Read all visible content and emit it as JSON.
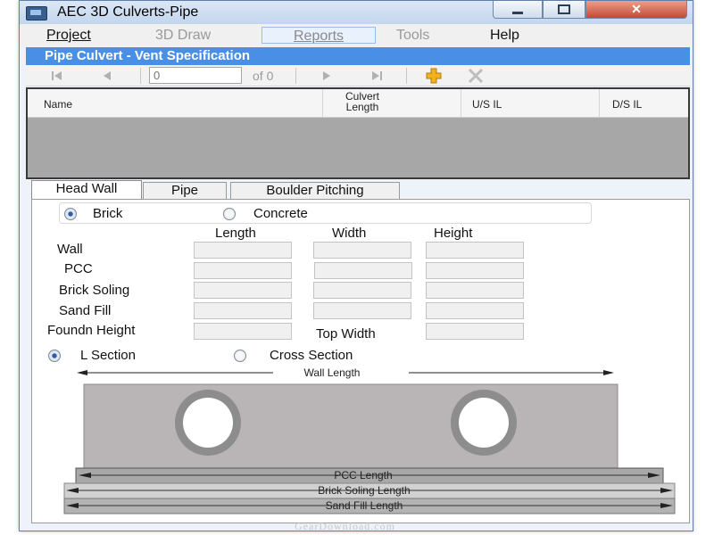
{
  "window": {
    "title": "AEC 3D Culverts-Pipe",
    "close_glyph": "✕"
  },
  "menu": {
    "items": [
      {
        "label": "Project",
        "state": "normal"
      },
      {
        "label": "3D Draw",
        "state": "disabled"
      },
      {
        "label": "Reports",
        "state": "hover"
      },
      {
        "label": "Tools",
        "state": "disabled"
      },
      {
        "label": "Help",
        "state": "normal"
      }
    ]
  },
  "banner": {
    "title": "Pipe Culvert - Vent Specification"
  },
  "navigator": {
    "position": "0",
    "of_label": "of 0"
  },
  "grid": {
    "columns": [
      "Name",
      "Culvert Length",
      "U/S IL",
      "D/S IL"
    ]
  },
  "tabs": [
    {
      "label": "Head Wall",
      "active": true
    },
    {
      "label": "Pipe",
      "active": false
    },
    {
      "label": "Boulder Pitching",
      "active": false
    }
  ],
  "material": {
    "options": [
      {
        "label": "Brick",
        "checked": true
      },
      {
        "label": "Concrete",
        "checked": false
      }
    ]
  },
  "dimensions": {
    "columns": [
      "Length",
      "Width",
      "Height"
    ],
    "rows": [
      "Wall",
      "PCC",
      "Brick Soling",
      "Sand Fill",
      "Foundn Height"
    ],
    "top_width_label": "Top Width"
  },
  "section": {
    "options": [
      {
        "label": "L Section",
        "checked": true
      },
      {
        "label": "Cross Section",
        "checked": false
      }
    ]
  },
  "diagram": {
    "labels": {
      "wall_length": "Wall Length",
      "pcc_length": "PCC Length",
      "brick_soling_length": "Brick Soling Length",
      "sand_fill_length": "Sand Fill Length"
    },
    "colors": {
      "wall": "#b9b4b5",
      "pipe_ring": "#8d8d8d",
      "pipe_bore": "#ffffff",
      "pcc": "#a8a8a8",
      "soling": "#d1d1d1",
      "sand": "#b3b3b3"
    }
  },
  "watermark": "GearDownload.com"
}
